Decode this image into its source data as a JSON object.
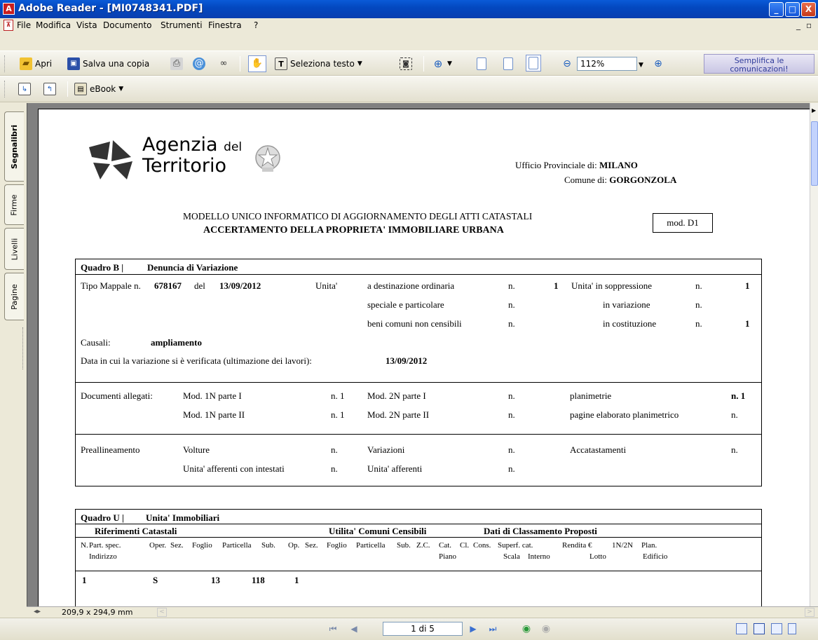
{
  "window": {
    "title": "Adobe Reader - [MI0748341.PDF]",
    "minimize": "_",
    "maximize": "□",
    "close": "X"
  },
  "menu": {
    "items": [
      "File",
      "Modifica",
      "Vista",
      "Documento",
      "Strumenti",
      "Finestra",
      "?"
    ],
    "mdi_minimize": "_",
    "mdi_restore": "▫"
  },
  "toolbar": {
    "open_label": "Apri",
    "save_copy_label": "Salva una copia",
    "select_text_label": "Seleziona testo",
    "zoom_value": "112%",
    "promo_label_1": "Semplifica le",
    "promo_label_2": "comunicazioni!",
    "ebook_label": "eBook"
  },
  "side_tabs": [
    "Segnalibri",
    "Firme",
    "Livelli",
    "Pagine"
  ],
  "document": {
    "agency_name_1": "Agenzia",
    "agency_del": "del",
    "agency_name_2": "Territorio",
    "office_label": "Ufficio Provinciale di:",
    "office_value": "MILANO",
    "comune_label": "Comune di:",
    "comune_value": "GORGONZOLA",
    "model_title": "MODELLO UNICO INFORMATICO DI AGGIORNAMENTO DEGLI ATTI CATASTALI",
    "model_subtitle": "ACCERTAMENTO DELLA PROPRIETA' IMMOBILIARE URBANA",
    "model_code": "mod. D1",
    "quadro_b": {
      "title_code": "Quadro B |",
      "title_text": "Denuncia di Variazione",
      "tipo_mappale_label": "Tipo Mappale n.",
      "tipo_mappale_value": "678167",
      "del_label": "del",
      "del_value": "13/09/2012",
      "unita_label": "Unita'",
      "dest_ordinaria": "a destinazione ordinaria",
      "speciale": "speciale e particolare",
      "beni_comuni": "beni comuni non censibili",
      "n_label": "n.",
      "dest_ordinaria_value": "1",
      "soppressione_label": "Unita' in soppressione",
      "soppressione_value": "1",
      "variazione_label": "in variazione",
      "costituzione_label": "in costituzione",
      "costituzione_value": "1",
      "causali_label": "Causali:",
      "causali_value": "ampliamento",
      "data_label": "Data in cui la variazione si è verificata (ultimazione dei lavori):",
      "data_value": "13/09/2012",
      "documenti_label": "Documenti allegati:",
      "mod1n_p1": "Mod. 1N parte I",
      "mod1n_p2": "Mod. 1N parte II",
      "mod2n_p1": "Mod. 2N parte I",
      "mod2n_p2": "Mod. 2N parte II",
      "n_1": "n.  1",
      "planimetrie": "planimetrie",
      "planimetrie_value": "n. 1",
      "elaborato": "pagine elaborato planimetrico",
      "preallineamento": "Preallineamento",
      "volture": "Volture",
      "variazioni": "Variazioni",
      "accatastamenti": "Accatastamenti",
      "afferenti_intestati": "Unita' afferenti con intestati",
      "afferenti": "Unita' afferenti"
    },
    "quadro_u": {
      "title_code": "Quadro U |",
      "title_text": "Unita' Immobiliari",
      "riferimenti": "Riferimenti Catastali",
      "utilita": "Utilita' Comuni Censibili",
      "classamento": "Dati di Classamento Proposti",
      "headers_row1": [
        "N.",
        "Part. spec.",
        "Oper.",
        "Sez.",
        "Foglio",
        "Particella",
        "Sub.",
        "Op.",
        "Sez.",
        "Foglio",
        "Particella",
        "Sub.",
        "Z.C.",
        "Cat.",
        "Cl.",
        "Cons.",
        "Superf. cat.",
        "Rendita €",
        "1N/2N",
        "Plan."
      ],
      "headers_row2": [
        "Indirizzo",
        "Piano",
        "Scala",
        "Interno",
        "Lotto",
        "Edificio"
      ],
      "row1": {
        "n": "1",
        "oper": "S",
        "foglio": "13",
        "particella": "118",
        "sub": "1"
      }
    }
  },
  "status": {
    "page_size": "209,9 x 294,9 mm",
    "page_indicator": "1 di 5"
  }
}
